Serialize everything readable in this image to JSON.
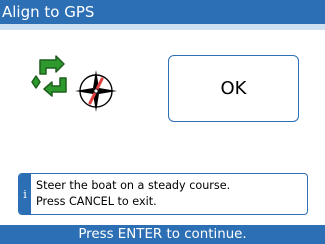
{
  "header": {
    "title": "Align to GPS"
  },
  "icons": {
    "sync": "sync-arrows-icon",
    "compass": "compass-icon"
  },
  "ok_button": {
    "label": "OK"
  },
  "info": {
    "badge": "i",
    "lines": [
      "Steer the boat on a steady course.",
      "Press CANCEL to exit."
    ]
  },
  "status": {
    "text": "Press ENTER to continue."
  },
  "colors": {
    "accent": "#2d6fb5",
    "accent_light": "#cfe0f3",
    "icon_green": "#2e9a2e",
    "compass_needle": "#e04040"
  }
}
